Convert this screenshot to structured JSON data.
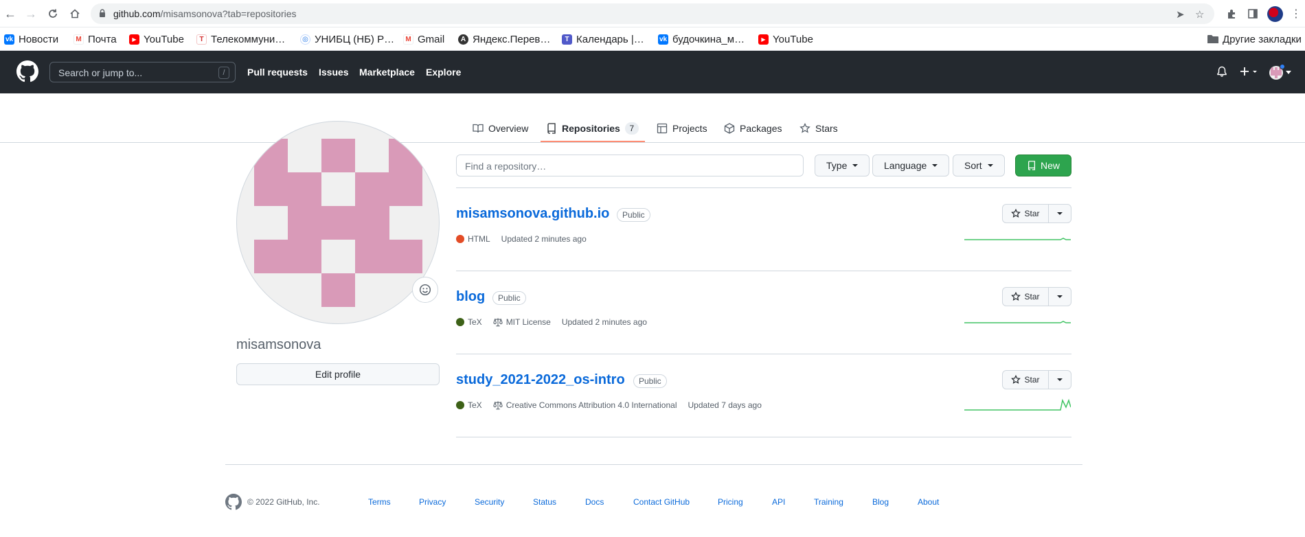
{
  "browser": {
    "url_host": "github.com",
    "url_path": "/misamsonova?tab=repositories"
  },
  "bookmarks": [
    {
      "label": "Новости",
      "icon": "vk-icon",
      "color": "#0077ff"
    },
    {
      "label": "Почта",
      "icon": "gmail-icon",
      "color": "#ea4335"
    },
    {
      "label": "YouTube",
      "icon": "youtube-icon",
      "color": "#ff0000"
    },
    {
      "label": "Телекоммуни…",
      "icon": "telecom-icon",
      "color": "#d32f2f"
    },
    {
      "label": "УНИБЦ (НБ) Р…",
      "icon": "unibc-icon",
      "color": "#1a73e8"
    },
    {
      "label": "Gmail",
      "icon": "gmail-icon",
      "color": "#ea4335"
    },
    {
      "label": "Яндекс.Перев…",
      "icon": "yandex-translate-icon",
      "color": "#333333"
    },
    {
      "label": "Календарь |…",
      "icon": "teams-icon",
      "color": "#5059c9"
    },
    {
      "label": "будочкина_м…",
      "icon": "vk-icon",
      "color": "#0077ff"
    },
    {
      "label": "YouTube",
      "icon": "youtube-icon",
      "color": "#ff0000"
    }
  ],
  "other_bookmarks": "Другие закладки",
  "header": {
    "search_placeholder": "Search or jump to...",
    "slash_hint": "/",
    "nav": [
      "Pull requests",
      "Issues",
      "Marketplace",
      "Explore"
    ]
  },
  "tabs": [
    {
      "label": "Overview",
      "icon": "book-icon"
    },
    {
      "label": "Repositories",
      "icon": "repo-icon",
      "count": "7",
      "active": true
    },
    {
      "label": "Projects",
      "icon": "table-icon"
    },
    {
      "label": "Packages",
      "icon": "package-icon"
    },
    {
      "label": "Stars",
      "icon": "star-icon"
    }
  ],
  "profile": {
    "username": "misamsonova",
    "edit_label": "Edit profile"
  },
  "controls": {
    "find_placeholder": "Find a repository…",
    "type_label": "Type",
    "language_label": "Language",
    "sort_label": "Sort",
    "new_label": "New"
  },
  "repos": [
    {
      "name": "misamsonova.github.io",
      "visibility": "Public",
      "language": "HTML",
      "lang_color": "#e34c26",
      "license": "",
      "updated": "Updated 2 minutes ago",
      "star_label": "Star"
    },
    {
      "name": "blog",
      "visibility": "Public",
      "language": "TeX",
      "lang_color": "#3d6117",
      "license": "MIT License",
      "updated": "Updated 2 minutes ago",
      "star_label": "Star"
    },
    {
      "name": "study_2021-2022_os-intro",
      "visibility": "Public",
      "language": "TeX",
      "lang_color": "#3d6117",
      "license": "Creative Commons Attribution 4.0 International",
      "updated": "Updated 7 days ago",
      "star_label": "Star"
    }
  ],
  "footer": {
    "copyright": "© 2022 GitHub, Inc.",
    "links": [
      "Terms",
      "Privacy",
      "Security",
      "Status",
      "Docs",
      "Contact GitHub",
      "Pricing",
      "API",
      "Training",
      "Blog",
      "About"
    ]
  }
}
